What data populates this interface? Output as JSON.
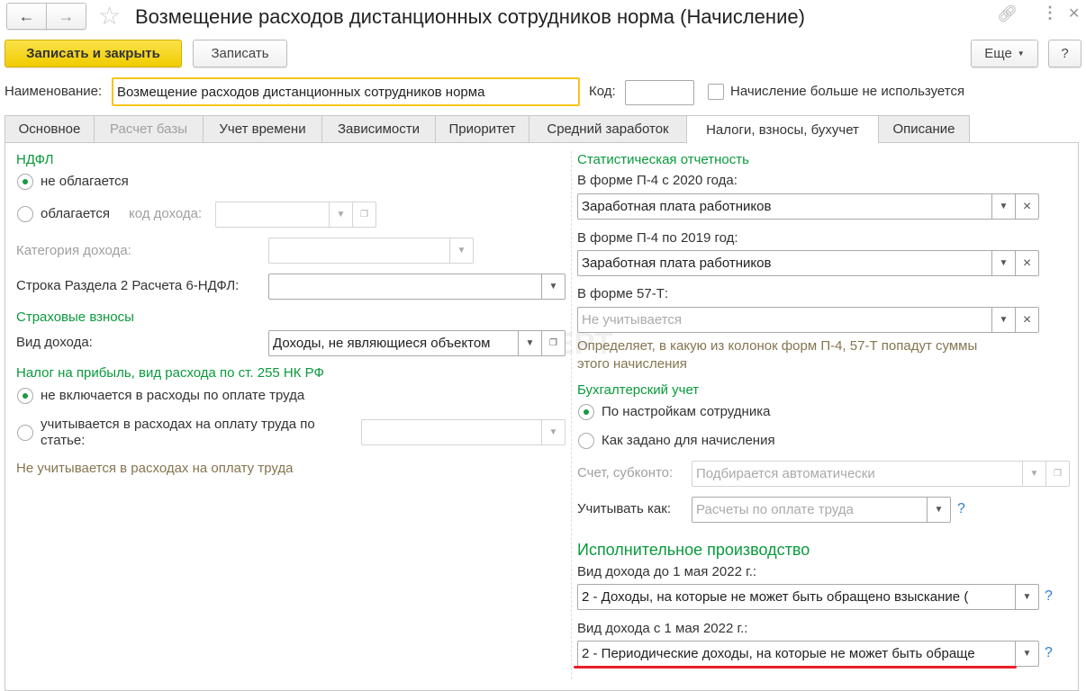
{
  "window": {
    "title": "Возмещение расходов дистанционных сотрудников норма (Начисление)"
  },
  "toolbar": {
    "save_close": "Записать и закрыть",
    "save": "Записать",
    "more": "Еще",
    "help": "?"
  },
  "header": {
    "name_label": "Наименование:",
    "name_value": "Возмещение расходов дистанционных сотрудников норма",
    "code_label": "Код:",
    "code_value": "",
    "unused_label": "Начисление больше не используется"
  },
  "tabs": [
    "Основное",
    "Расчет базы",
    "Учет времени",
    "Зависимости",
    "Приоритет",
    "Средний заработок",
    "Налоги, взносы, бухучет",
    "Описание"
  ],
  "left": {
    "ndfl_title": "НДФЛ",
    "ndfl_not_taxed": "не облагается",
    "ndfl_taxed": "облагается",
    "income_code_label": "код дохода:",
    "income_category_label": "Категория дохода:",
    "row6_label": "Строка Раздела 2 Расчета 6-НДФЛ:",
    "ins_title": "Страховые взносы",
    "ins_kind_label": "Вид дохода:",
    "ins_kind_value": "Доходы, не являющиеся объектом",
    "profit_title": "Налог на прибыль, вид расхода по ст. 255 НК РФ",
    "profit_not_incl": "не включается в расходы по оплате труда",
    "profit_incl_1": "учитывается в расходах на оплату труда по",
    "profit_incl_2": "статье:",
    "profit_hint": "Не учитывается в расходах на оплату труда"
  },
  "right": {
    "stat_title": "Статистическая отчетность",
    "p4_2020_label": "В форме П-4 с 2020 года:",
    "p4_2020_value": "Заработная плата работников",
    "p4_2019_label": "В форме П-4 по 2019 год:",
    "p4_2019_value": "Заработная плата работников",
    "f57_label": "В форме 57-Т:",
    "f57_placeholder": "Не учитывается",
    "stat_hint_1": "Определяет, в какую из колонок форм П-4, 57-Т попадут суммы",
    "stat_hint_2": "этого начисления",
    "acc_title": "Бухгалтерский учет",
    "acc_by_employee": "По настройкам сотрудника",
    "acc_as_set": "Как задано для начисления",
    "account_label": "Счет, субконто:",
    "account_placeholder": "Подбирается автоматически",
    "treat_label": "Учитывать как:",
    "treat_placeholder": "Расчеты по оплате труда",
    "exec_title": "Исполнительное производство",
    "before_label": "Вид дохода до 1 мая 2022 г.:",
    "before_value": "2 - Доходы, на которые не может быть обращено взыскание (",
    "after_label": "Вид дохода с 1 мая 2022 г.:",
    "after_value": "2 - Периодические доходы, на которые не может быть обраще",
    "help": "?"
  },
  "watermark": "БУХЭКСПЕРТ",
  "colors": {
    "accent_yellow": "#f5d300",
    "section_green": "#0a9a3c",
    "highlight_red": "#e8202a"
  }
}
